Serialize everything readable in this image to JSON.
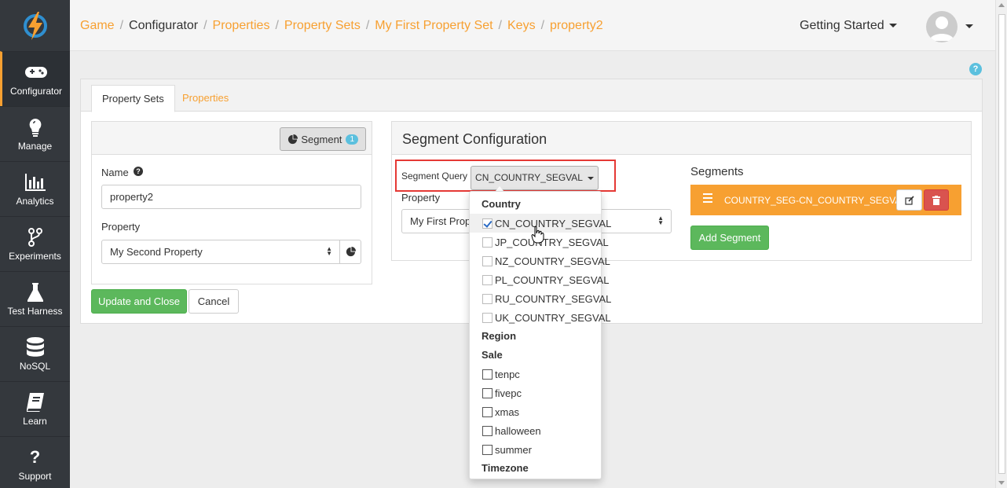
{
  "sidebar": {
    "items": [
      {
        "label": "Configurator",
        "icon": "gamepad-icon",
        "active": true
      },
      {
        "label": "Manage",
        "icon": "lightbulb-icon"
      },
      {
        "label": "Analytics",
        "icon": "bar-chart-icon"
      },
      {
        "label": "Experiments",
        "icon": "branch-icon"
      },
      {
        "label": "Test Harness",
        "icon": "flask-icon"
      },
      {
        "label": "NoSQL",
        "icon": "database-icon"
      },
      {
        "label": "Learn",
        "icon": "book-icon"
      },
      {
        "label": "Support",
        "icon": "question-icon"
      }
    ]
  },
  "breadcrumb": [
    "Game",
    "Configurator",
    "Properties",
    "Property Sets",
    "My First Property Set",
    "Keys",
    "property2"
  ],
  "header": {
    "getting_started": "Getting Started"
  },
  "tabs": [
    {
      "label": "Property Sets",
      "active": true
    },
    {
      "label": "Properties"
    }
  ],
  "left_panel": {
    "segment_button": "Segment",
    "segment_count": "1",
    "name_label": "Name",
    "name_value": "property2",
    "property_label": "Property",
    "property_value": "My Second Property"
  },
  "actions": {
    "update": "Update and Close",
    "cancel": "Cancel"
  },
  "segment_config": {
    "title": "Segment Configuration",
    "query_label": "Segment Query",
    "query_value": "CN_COUNTRY_SEGVAL",
    "property_label": "Property",
    "property_value": "My First Property"
  },
  "segments": {
    "title": "Segments",
    "items": [
      "COUNTRY_SEG-CN_COUNTRY_SEGVAL"
    ],
    "add_label": "Add Segment"
  },
  "dropdown": {
    "groups": {
      "country": "Country",
      "region": "Region",
      "sale": "Sale",
      "timezone": "Timezone"
    },
    "country_items": [
      {
        "label": "CN_COUNTRY_SEGVAL",
        "checked": true
      },
      {
        "label": "JP_COUNTRY_SEGVAL",
        "checked": false
      },
      {
        "label": "NZ_COUNTRY_SEGVAL",
        "checked": false
      },
      {
        "label": "PL_COUNTRY_SEGVAL",
        "checked": false
      },
      {
        "label": "RU_COUNTRY_SEGVAL",
        "checked": false
      },
      {
        "label": "UK_COUNTRY_SEGVAL",
        "checked": false
      }
    ],
    "sale_items": [
      {
        "label": "tenpc",
        "checked": false
      },
      {
        "label": "fivepc",
        "checked": false
      },
      {
        "label": "xmas",
        "checked": false
      },
      {
        "label": "halloween",
        "checked": false
      },
      {
        "label": "summer",
        "checked": false
      }
    ]
  },
  "colors": {
    "accent": "#f7a031",
    "sidebar": "#34383d",
    "success": "#5cb85c",
    "danger": "#d9534f",
    "info": "#5bc0de",
    "highlight_border": "#e53935"
  }
}
